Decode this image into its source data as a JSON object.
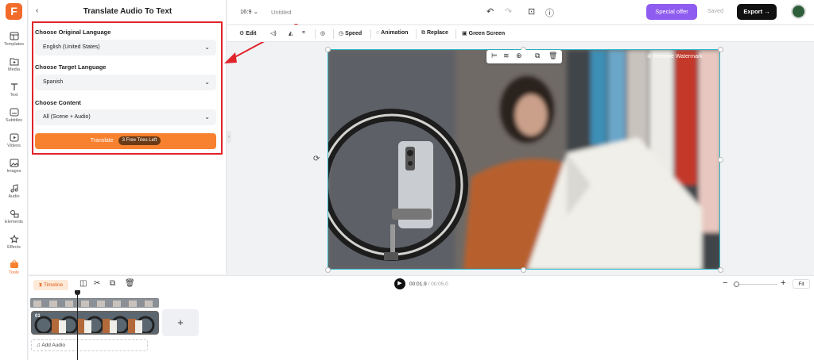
{
  "sidebar": {
    "logo": "F",
    "items": [
      {
        "label": "Templates",
        "icon": "layout-icon"
      },
      {
        "label": "Media",
        "icon": "media-icon"
      },
      {
        "label": "Text",
        "icon": "text-icon"
      },
      {
        "label": "Subtitles",
        "icon": "subtitles-icon"
      },
      {
        "label": "Videos",
        "icon": "video-icon"
      },
      {
        "label": "Images",
        "icon": "image-icon"
      },
      {
        "label": "Audio",
        "icon": "music-icon"
      },
      {
        "label": "Elements",
        "icon": "elements-icon"
      },
      {
        "label": "Effects",
        "icon": "effects-icon"
      },
      {
        "label": "Tools",
        "icon": "tools-icon",
        "active": true
      }
    ]
  },
  "panel": {
    "title": "Translate Audio To Text",
    "back": "‹",
    "original_label": "Choose Original Language",
    "original_value": "English (United States)",
    "target_label": "Choose Target Language",
    "target_value": "Spanish",
    "content_label": "Choose Content",
    "content_value": "All (Scene + Audio)",
    "translate_label": "Translate",
    "tries_label": "3 Free Tries Left"
  },
  "topbar": {
    "ratio": "16:9",
    "doc_title": "Untitled",
    "special_offer": "Special offer",
    "saved": "Saved",
    "export": "Export"
  },
  "toolbar": {
    "edit": "Edit",
    "speed": "Speed",
    "animation": "Animation",
    "replace": "Replace",
    "green_screen": "Green Screen"
  },
  "canvas": {
    "watermark": "Remove Watermark"
  },
  "timeline": {
    "tab": "Timeline",
    "current_time": "00:01.9",
    "total_time": "/ 00:05.0",
    "fit": "Fit",
    "clip_number": "01",
    "add_audio": "Add Audio",
    "add_clip": "+"
  },
  "colors": {
    "accent": "#f7812e",
    "special": "#8e5cf0",
    "annotation": "#e0242a"
  }
}
